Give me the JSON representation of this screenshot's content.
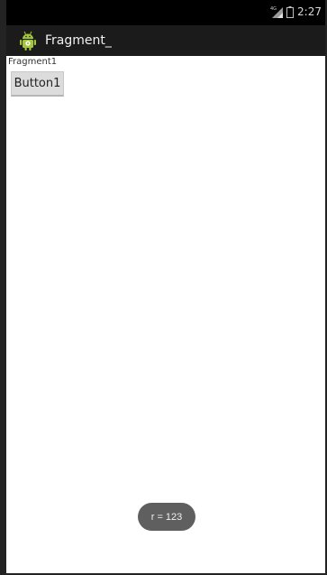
{
  "status_bar": {
    "network_type": "4G",
    "time": "2:27",
    "icons": [
      "signal-icon",
      "battery-icon"
    ]
  },
  "action_bar": {
    "app_icon": "android-app-icon",
    "title": "Fragment_"
  },
  "content": {
    "fragment_label": "Fragment1",
    "button_label": "Button1"
  },
  "toast": {
    "text": "r = 123"
  },
  "colors": {
    "status_bar_bg": "#000000",
    "action_bar_bg": "#1b1b1b",
    "content_bg": "#ffffff",
    "button_bg": "#dcdcdc",
    "toast_bg": "#5f5f5f",
    "android_green": "#a4c639"
  }
}
